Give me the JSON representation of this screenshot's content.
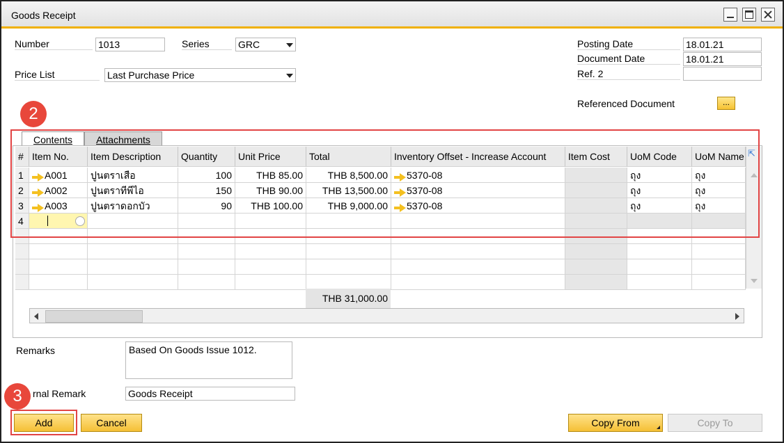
{
  "window": {
    "title": "Goods Receipt"
  },
  "header": {
    "number_label": "Number",
    "number_value": "1013",
    "series_label": "Series",
    "series_value": "GRC",
    "price_list_label": "Price List",
    "price_list_value": "Last Purchase Price",
    "posting_date_label": "Posting Date",
    "posting_date_value": "18.01.21",
    "document_date_label": "Document Date",
    "document_date_value": "18.01.21",
    "ref2_label": "Ref. 2",
    "ref2_value": "",
    "referenced_document_label": "Referenced Document",
    "referenced_document_button": "..."
  },
  "badges": {
    "b2": "2",
    "b3": "3"
  },
  "tabs": [
    {
      "label": "Contents"
    },
    {
      "label": "Attachments"
    }
  ],
  "grid": {
    "columns": [
      "#",
      "Item No.",
      "Item Description",
      "Quantity",
      "Unit Price",
      "Total",
      "Inventory Offset - Increase Account",
      "Item Cost",
      "UoM Code",
      "UoM Name"
    ],
    "rows": [
      {
        "num": "1",
        "item_no": "A001",
        "desc": "ปูนตราเสือ",
        "qty": "100",
        "unit_price": "THB 85.00",
        "total": "THB 8,500.00",
        "account": "5370-08",
        "item_cost": "",
        "uom_code": "ถุง",
        "uom_name": "ถุง"
      },
      {
        "num": "2",
        "item_no": "A002",
        "desc": "ปูนตราทีพีไอ",
        "qty": "150",
        "unit_price": "THB 90.00",
        "total": "THB 13,500.00",
        "account": "5370-08",
        "item_cost": "",
        "uom_code": "ถุง",
        "uom_name": "ถุง"
      },
      {
        "num": "3",
        "item_no": "A003",
        "desc": "ปูนตราดอกบัว",
        "qty": "90",
        "unit_price": "THB 100.00",
        "total": "THB 9,000.00",
        "account": "5370-08",
        "item_cost": "",
        "uom_code": "ถุง",
        "uom_name": "ถุง"
      }
    ],
    "new_row_num": "4",
    "grand_total": "THB 31,000.00"
  },
  "footer": {
    "remarks_label": "Remarks",
    "remarks_value": "Based On Goods Issue 1012.",
    "journal_remark_label": "rnal Remark",
    "journal_remark_value": "Goods Receipt"
  },
  "buttons": {
    "add": "Add",
    "cancel": "Cancel",
    "copy_from": "Copy From",
    "copy_to": "Copy To"
  },
  "colors": {
    "accent": "#f0b000",
    "highlight_red": "#e24444",
    "button_yellow": "#f5c035"
  }
}
